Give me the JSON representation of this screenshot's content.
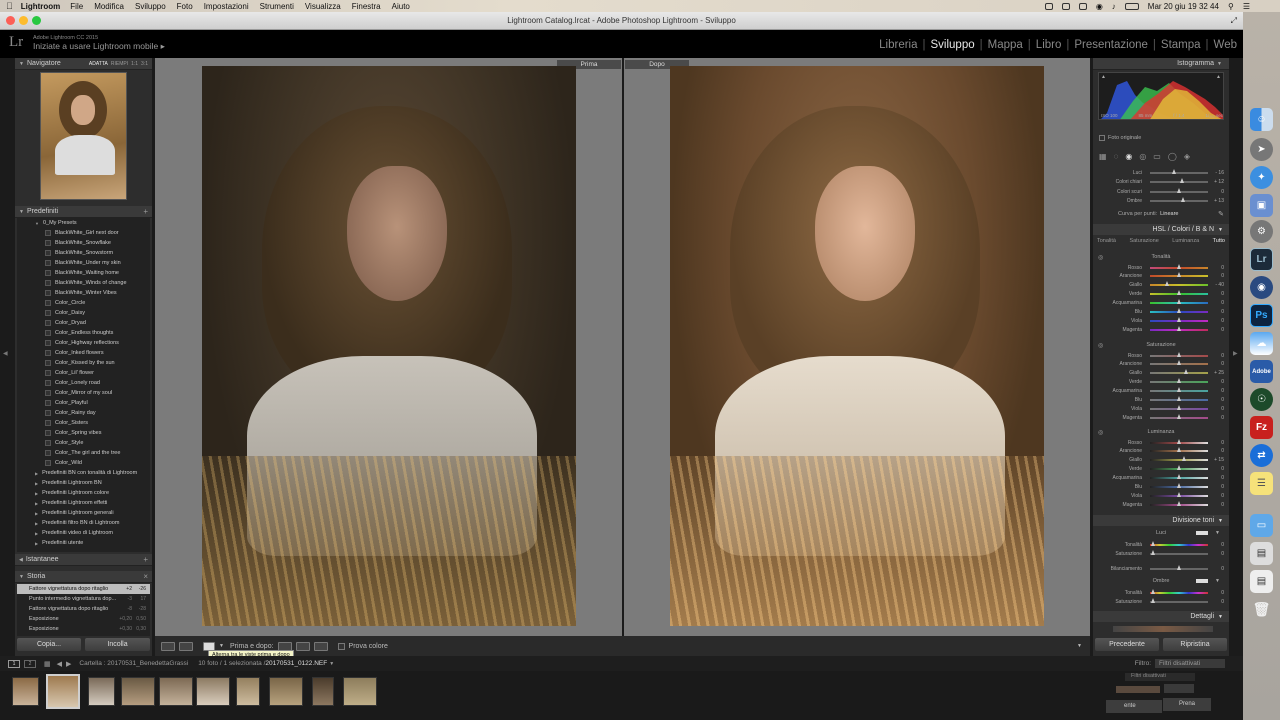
{
  "menubar": {
    "app": "Lightroom",
    "items": [
      "File",
      "Modifica",
      "Sviluppo",
      "Foto",
      "Impostazioni",
      "Strumenti",
      "Visualizza",
      "Finestra",
      "Aiuto"
    ],
    "clock": "Mar 20 giu  19 32 44"
  },
  "window": {
    "title": "Lightroom Catalog.lrcat - Adobe Photoshop Lightroom - Sviluppo"
  },
  "identity": {
    "logo": "Lr",
    "line1": "Adobe Lightroom CC 2015",
    "line2": "Iniziate a usare Lightroom mobile",
    "arrow": "▸"
  },
  "modules": [
    "Libreria",
    "Sviluppo",
    "Mappa",
    "Libro",
    "Presentazione",
    "Stampa",
    "Web"
  ],
  "left": {
    "navigator": {
      "title": "Navigatore",
      "zoom": [
        "ADATTA",
        "RIEMPI",
        "1:1",
        "3:1"
      ]
    },
    "presets": {
      "title": "Predefiniti",
      "folder": "0_My Presets",
      "items": [
        "BlackWhite_Girl next door",
        "BlackWhite_Snowflake",
        "BlackWhite_Snowstorm",
        "BlackWhite_Under my skin",
        "BlackWhite_Waiting home",
        "BlackWhite_Winds of change",
        "BlackWhite_Winter Vibes",
        "Color_Circle",
        "Color_Daisy",
        "Color_Dryad",
        "Color_Endless thoughts",
        "Color_Highway reflections",
        "Color_Inked flowers",
        "Color_Kissed by the sun",
        "Color_Lil' flower",
        "Color_Lonely road",
        "Color_Mirror of my soul",
        "Color_Playful",
        "Color_Rainy day",
        "Color_Sisters",
        "Color_Spring vibes",
        "Color_Style",
        "Color_The girl and the tree",
        "Color_Wild"
      ],
      "groups": [
        "Predefiniti BN con tonalità di Lightroom",
        "Predefiniti Lightroom BN",
        "Predefiniti Lightroom colore",
        "Predefiniti Lightroom effetti",
        "Predefiniti Lightroom generali",
        "Predefiniti filtro BN di Lightroom",
        "Predefiniti video di Lightroom",
        "Predefiniti utente"
      ]
    },
    "snapshots": {
      "title": "Istantanee"
    },
    "history": {
      "title": "Storia",
      "rows": [
        {
          "label": "Fattore vignettatura dopo ritaglio",
          "v1": "+2",
          "v2": "-26"
        },
        {
          "label": "Punto intermedio vignettatura dop...",
          "v1": "-3",
          "v2": "17"
        },
        {
          "label": "Fattore vignettatura dopo ritaglio",
          "v1": "-8",
          "v2": "-28"
        },
        {
          "label": "Esposizione",
          "v1": "+0,20",
          "v2": "0,50"
        },
        {
          "label": "Esposizione",
          "v1": "+0,30",
          "v2": "0,30"
        }
      ]
    },
    "copy_label": "Copia...",
    "paste_label": "Incolla"
  },
  "center": {
    "before_label": "Prima",
    "after_label": "Dopo"
  },
  "toolbar": {
    "before_after_label": "Prima e dopo:",
    "proof_label": "Prova colore",
    "tooltip": "Alterna tra le viste prima e dopo"
  },
  "right": {
    "histogram": {
      "title": "Istogramma",
      "iso": "ISO 100",
      "focal": "85 mm",
      "aperture": "f / 1,4",
      "shutter": "1/₂₀₀ sec",
      "original": "Foto originale"
    },
    "tone": [
      {
        "label": "Luci",
        "value": "- 16",
        "pos": 0.42
      },
      {
        "label": "Colori chiari",
        "value": "+ 12",
        "pos": 0.56
      },
      {
        "label": "Colori scuri",
        "value": "0",
        "pos": 0.5
      },
      {
        "label": "Ombre",
        "value": "+ 13",
        "pos": 0.57
      }
    ],
    "curve_label": "Curva per punti:",
    "curve_value": "Lineare",
    "hsl": {
      "title": "HSL  /  Colori  /  B & N",
      "tabs": [
        "Tonalità",
        "Saturazione",
        "Luminanza",
        "Tutto"
      ],
      "hue_title": "Tonalità",
      "sat_title": "Saturazione",
      "lum_title": "Luminanza",
      "colors": [
        "Rosso",
        "Arancione",
        "Giallo",
        "Verde",
        "Acquamarina",
        "Blu",
        "Viola",
        "Magenta"
      ],
      "hue_values": [
        "0",
        "0",
        "- 40",
        "0",
        "0",
        "0",
        "0",
        "0"
      ],
      "sat_values": [
        "0",
        "0",
        "+ 25",
        "0",
        "0",
        "0",
        "0",
        "0"
      ],
      "lum_values": [
        "0",
        "0",
        "+ 15",
        "0",
        "0",
        "0",
        "0",
        "0"
      ],
      "hue_pos": [
        0.5,
        0.5,
        0.3,
        0.5,
        0.5,
        0.5,
        0.5,
        0.5
      ],
      "sat_pos": [
        0.5,
        0.5,
        0.62,
        0.5,
        0.5,
        0.5,
        0.5,
        0.5
      ],
      "lum_pos": [
        0.5,
        0.5,
        0.58,
        0.5,
        0.5,
        0.5,
        0.5,
        0.5
      ]
    },
    "split": {
      "title": "Divisione toni",
      "highlights": "Luci",
      "shadows": "Ombre",
      "hue": "Tonalità",
      "sat": "Saturazione",
      "balance": "Bilanciamento",
      "zero": "0"
    },
    "detail": {
      "title": "Dettagli"
    },
    "previous_label": "Precedente",
    "reset_label": "Ripristina"
  },
  "filmbar": {
    "folder": "Cartella : 20170531_BenedettaGrassi",
    "count": "10 foto / 1 selezionata / ",
    "filename": "20170531_0122.NEF",
    "filter_label": "Filtro:",
    "filter_value": "Filtri disattivati",
    "filter_popup": "Filtri disattivati",
    "ghost_label": "ente",
    "ghost_button": "Prena"
  },
  "colors": {
    "accent": "#e8e8e8",
    "panel": "#2d2d2d",
    "background": "#1b1b1b"
  }
}
